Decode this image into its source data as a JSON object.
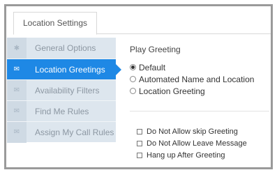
{
  "tab": {
    "label": "Location Settings"
  },
  "sidebar": {
    "items": [
      {
        "label": "General Options",
        "icon": "gear-icon",
        "active": false
      },
      {
        "label": "Location Greetings",
        "icon": "envelope-icon",
        "active": true
      },
      {
        "label": "Availability Filters",
        "icon": "envelope-icon",
        "active": false
      },
      {
        "label": "Find Me Rules",
        "icon": "envelope-icon",
        "active": false
      },
      {
        "label": "Assign My Call Rules",
        "icon": "envelope-icon",
        "active": false
      }
    ]
  },
  "greeting": {
    "title": "Play Greeting",
    "options": [
      {
        "label": "Default",
        "checked": true
      },
      {
        "label": "Automated Name and Location",
        "checked": false
      },
      {
        "label": "Location Greeting",
        "checked": false
      }
    ]
  },
  "options": {
    "checkboxes": [
      {
        "label": "Do Not Allow skip Greeting",
        "checked": false
      },
      {
        "label": "Do Not Allow Leave Message",
        "checked": false
      },
      {
        "label": "Hang up After Greeting",
        "checked": false
      }
    ]
  },
  "colors": {
    "accent": "#1e88e5",
    "sidebar_bg": "#dde6ee",
    "frame": "#9a9a9a"
  }
}
